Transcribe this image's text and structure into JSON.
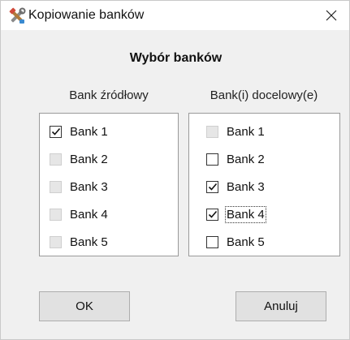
{
  "window": {
    "title": "Kopiowanie banków",
    "app_icon": "tools-icon",
    "close_icon": "close-icon"
  },
  "heading": "Wybór banków",
  "source": {
    "label": "Bank źródłowy",
    "items": [
      {
        "label": "Bank 1",
        "checked": true,
        "enabled": true
      },
      {
        "label": "Bank 2",
        "checked": false,
        "enabled": false
      },
      {
        "label": "Bank 3",
        "checked": false,
        "enabled": false
      },
      {
        "label": "Bank 4",
        "checked": false,
        "enabled": false
      },
      {
        "label": "Bank 5",
        "checked": false,
        "enabled": false
      }
    ]
  },
  "destination": {
    "label": "Bank(i) docelowy(e)",
    "items": [
      {
        "label": "Bank 1",
        "checked": false,
        "enabled": false
      },
      {
        "label": "Bank 2",
        "checked": false,
        "enabled": true
      },
      {
        "label": "Bank 3",
        "checked": true,
        "enabled": true
      },
      {
        "label": "Bank 4",
        "checked": true,
        "enabled": true,
        "focused": true
      },
      {
        "label": "Bank 5",
        "checked": false,
        "enabled": true
      }
    ]
  },
  "buttons": {
    "ok": "OK",
    "cancel": "Anuluj"
  },
  "colors": {
    "window_bg": "#f0f0f0",
    "button_bg": "#e1e1e1",
    "button_border": "#adadad"
  }
}
